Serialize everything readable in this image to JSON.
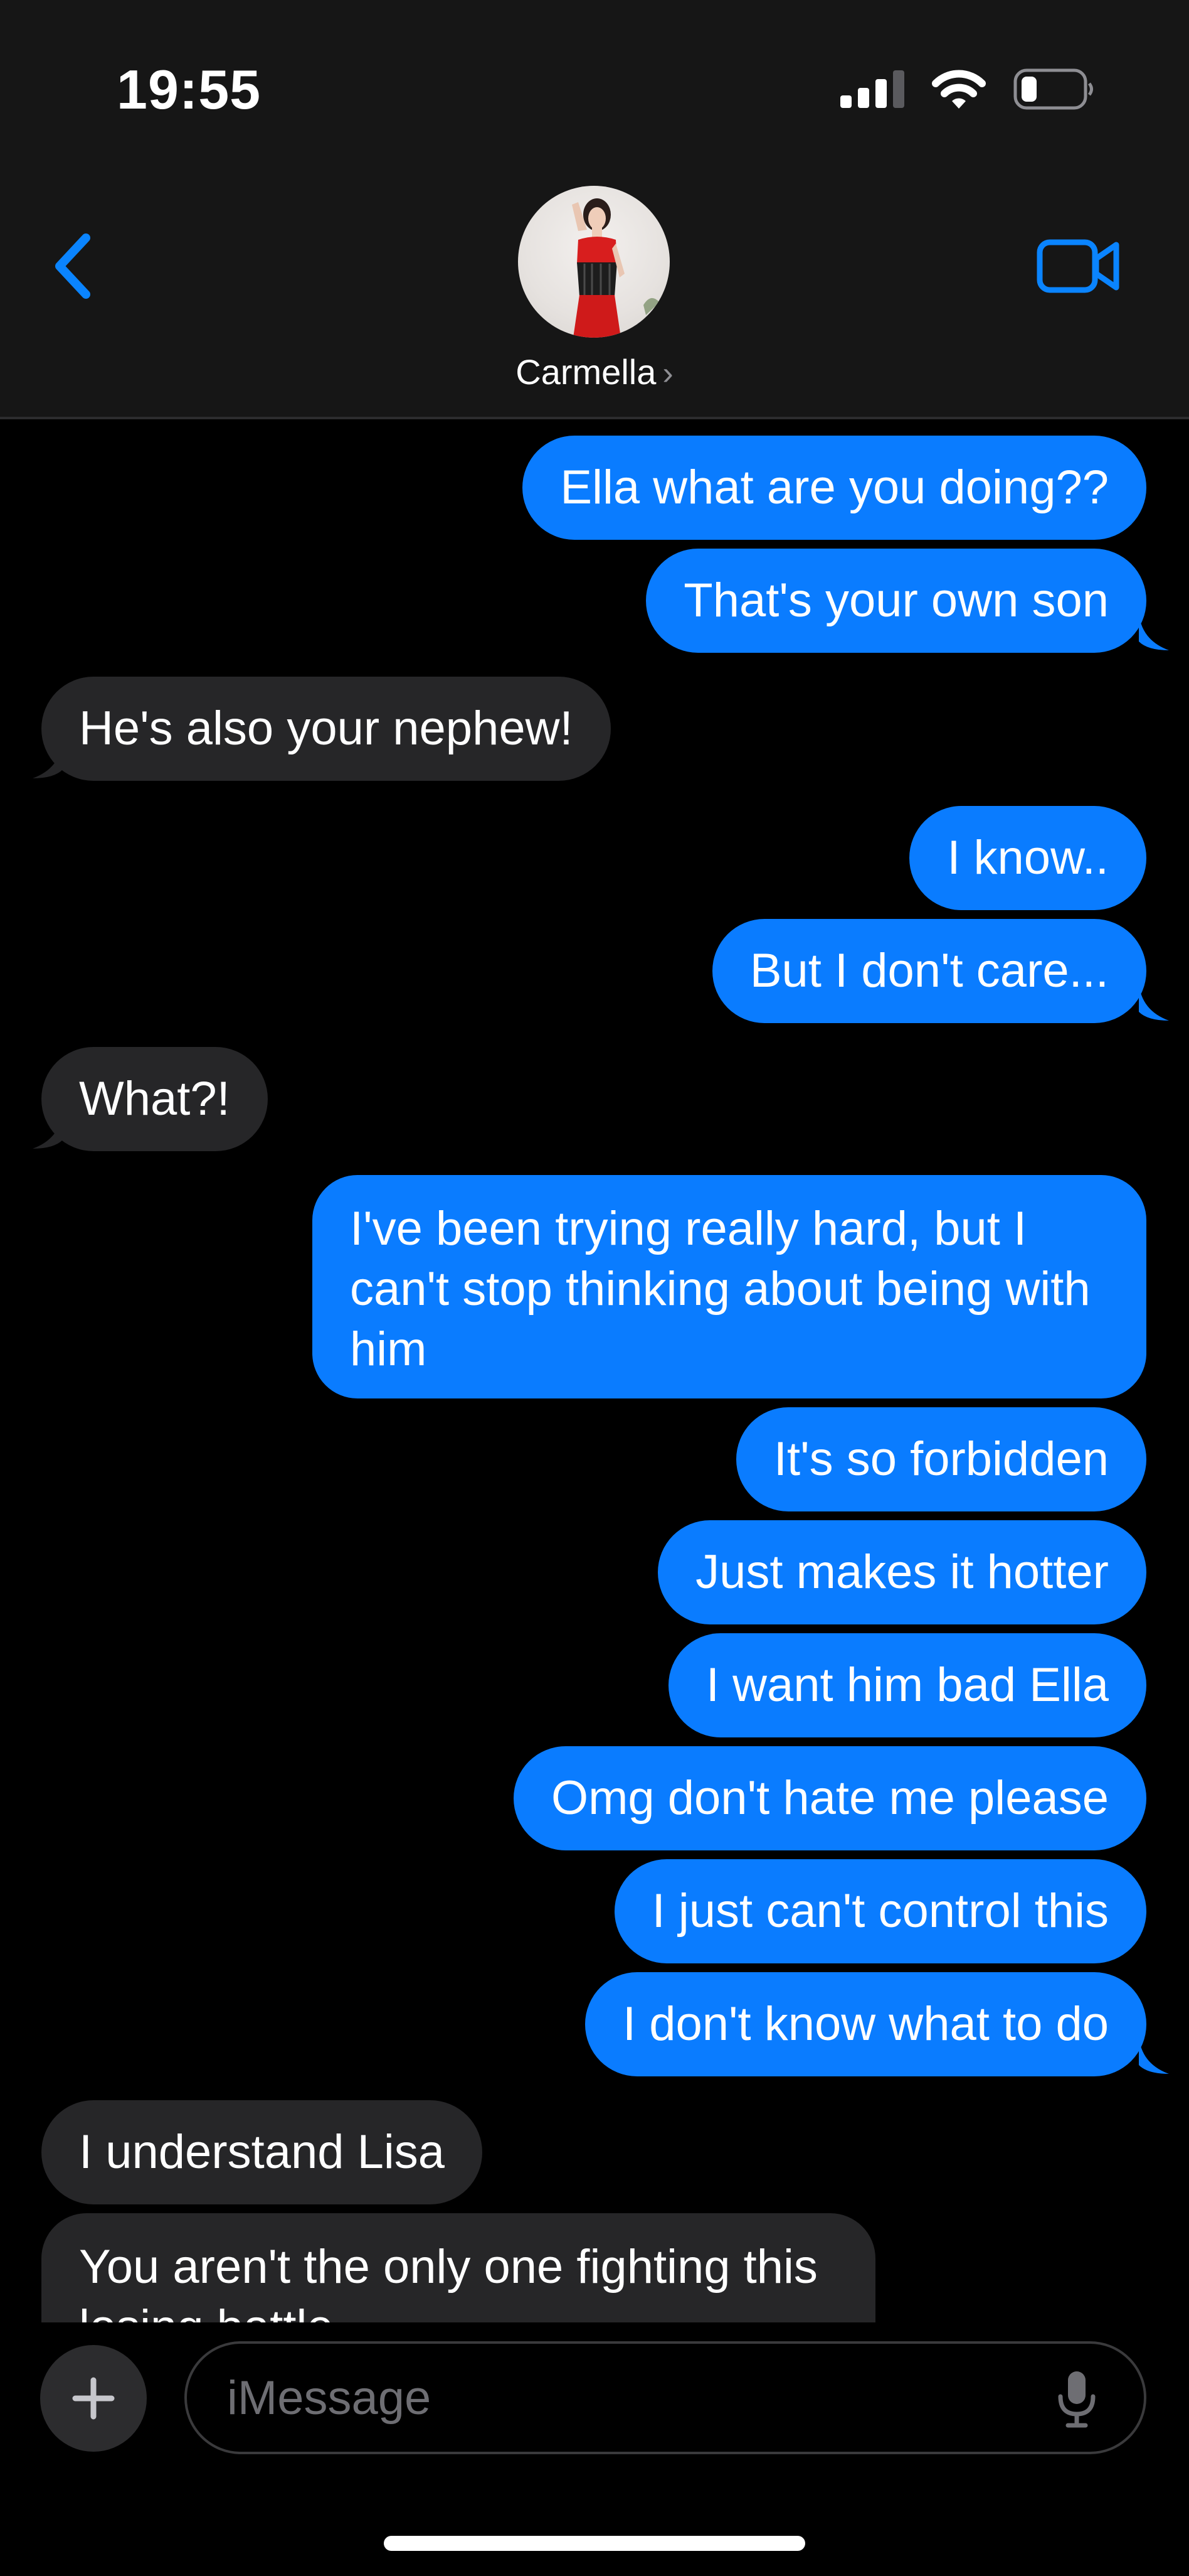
{
  "status_bar": {
    "time": "19:55",
    "signal_icon": "cellular-signal-icon",
    "wifi_icon": "wifi-icon",
    "battery_icon": "battery-low-icon"
  },
  "header": {
    "back_icon": "chevron-left-icon",
    "contact_name": "Carmella",
    "name_chevron": "›",
    "video_icon": "video-camera-icon"
  },
  "messages": [
    {
      "side": "out",
      "text": "Ella what are you doing??"
    },
    {
      "side": "out",
      "text": "That's your own son"
    },
    {
      "side": "in",
      "text": "He's also your nephew!"
    },
    {
      "side": "out",
      "text": "I know.."
    },
    {
      "side": "out",
      "text": "But I don't care..."
    },
    {
      "side": "in",
      "text": "What?!"
    },
    {
      "side": "out",
      "text": "I've been trying really hard, but I can't stop thinking about being with him"
    },
    {
      "side": "out",
      "text": "It's so forbidden"
    },
    {
      "side": "out",
      "text": "Just makes it hotter"
    },
    {
      "side": "out",
      "text": "I want him bad Ella"
    },
    {
      "side": "out",
      "text": "Omg don't hate me please"
    },
    {
      "side": "out",
      "text": "I just can't control this"
    },
    {
      "side": "out",
      "text": "I don't know what to do"
    },
    {
      "side": "in",
      "text": "I understand Lisa"
    },
    {
      "side": "in",
      "text": "You aren't the only one fighting this losing battle"
    }
  ],
  "composer": {
    "plus_icon": "plus-icon",
    "placeholder": "iMessage",
    "mic_icon": "microphone-icon"
  },
  "colors": {
    "outgoing_bubble": "#0a7cff",
    "incoming_bubble": "#262628",
    "accent": "#0a84ff",
    "header_bg": "#161616"
  }
}
